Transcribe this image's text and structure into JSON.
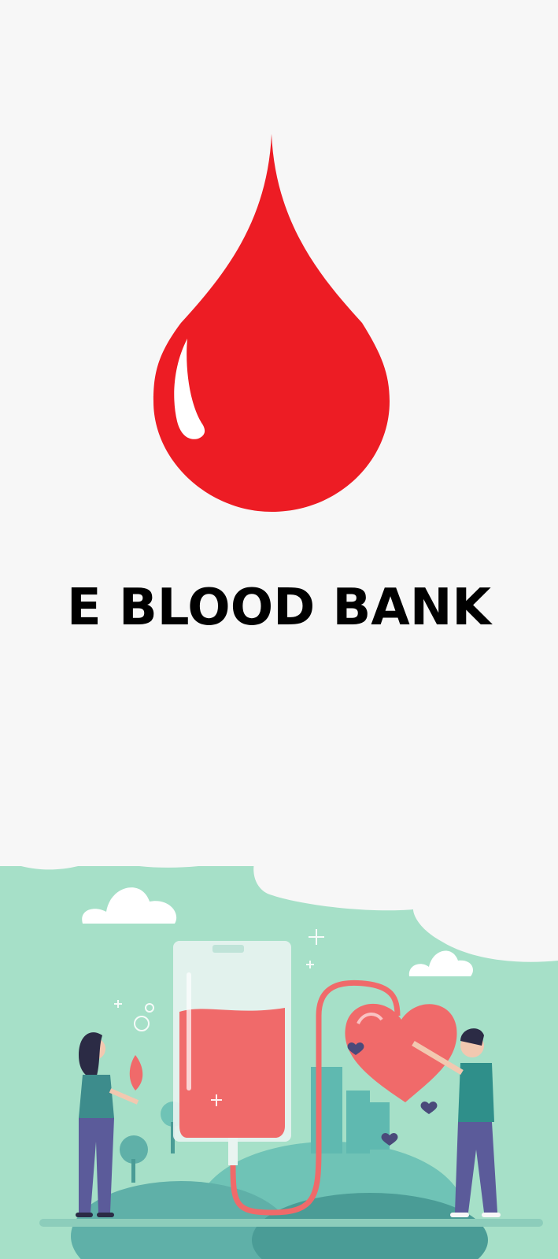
{
  "app": {
    "title": "E BLOOD BANK"
  },
  "logo": {
    "icon": "blood-drop-icon",
    "color": "#ED1C24"
  },
  "illustration": {
    "icon": "blood-donation-illustration",
    "background_color": "#A6E0C8",
    "blood_color": "#F06A6A"
  }
}
